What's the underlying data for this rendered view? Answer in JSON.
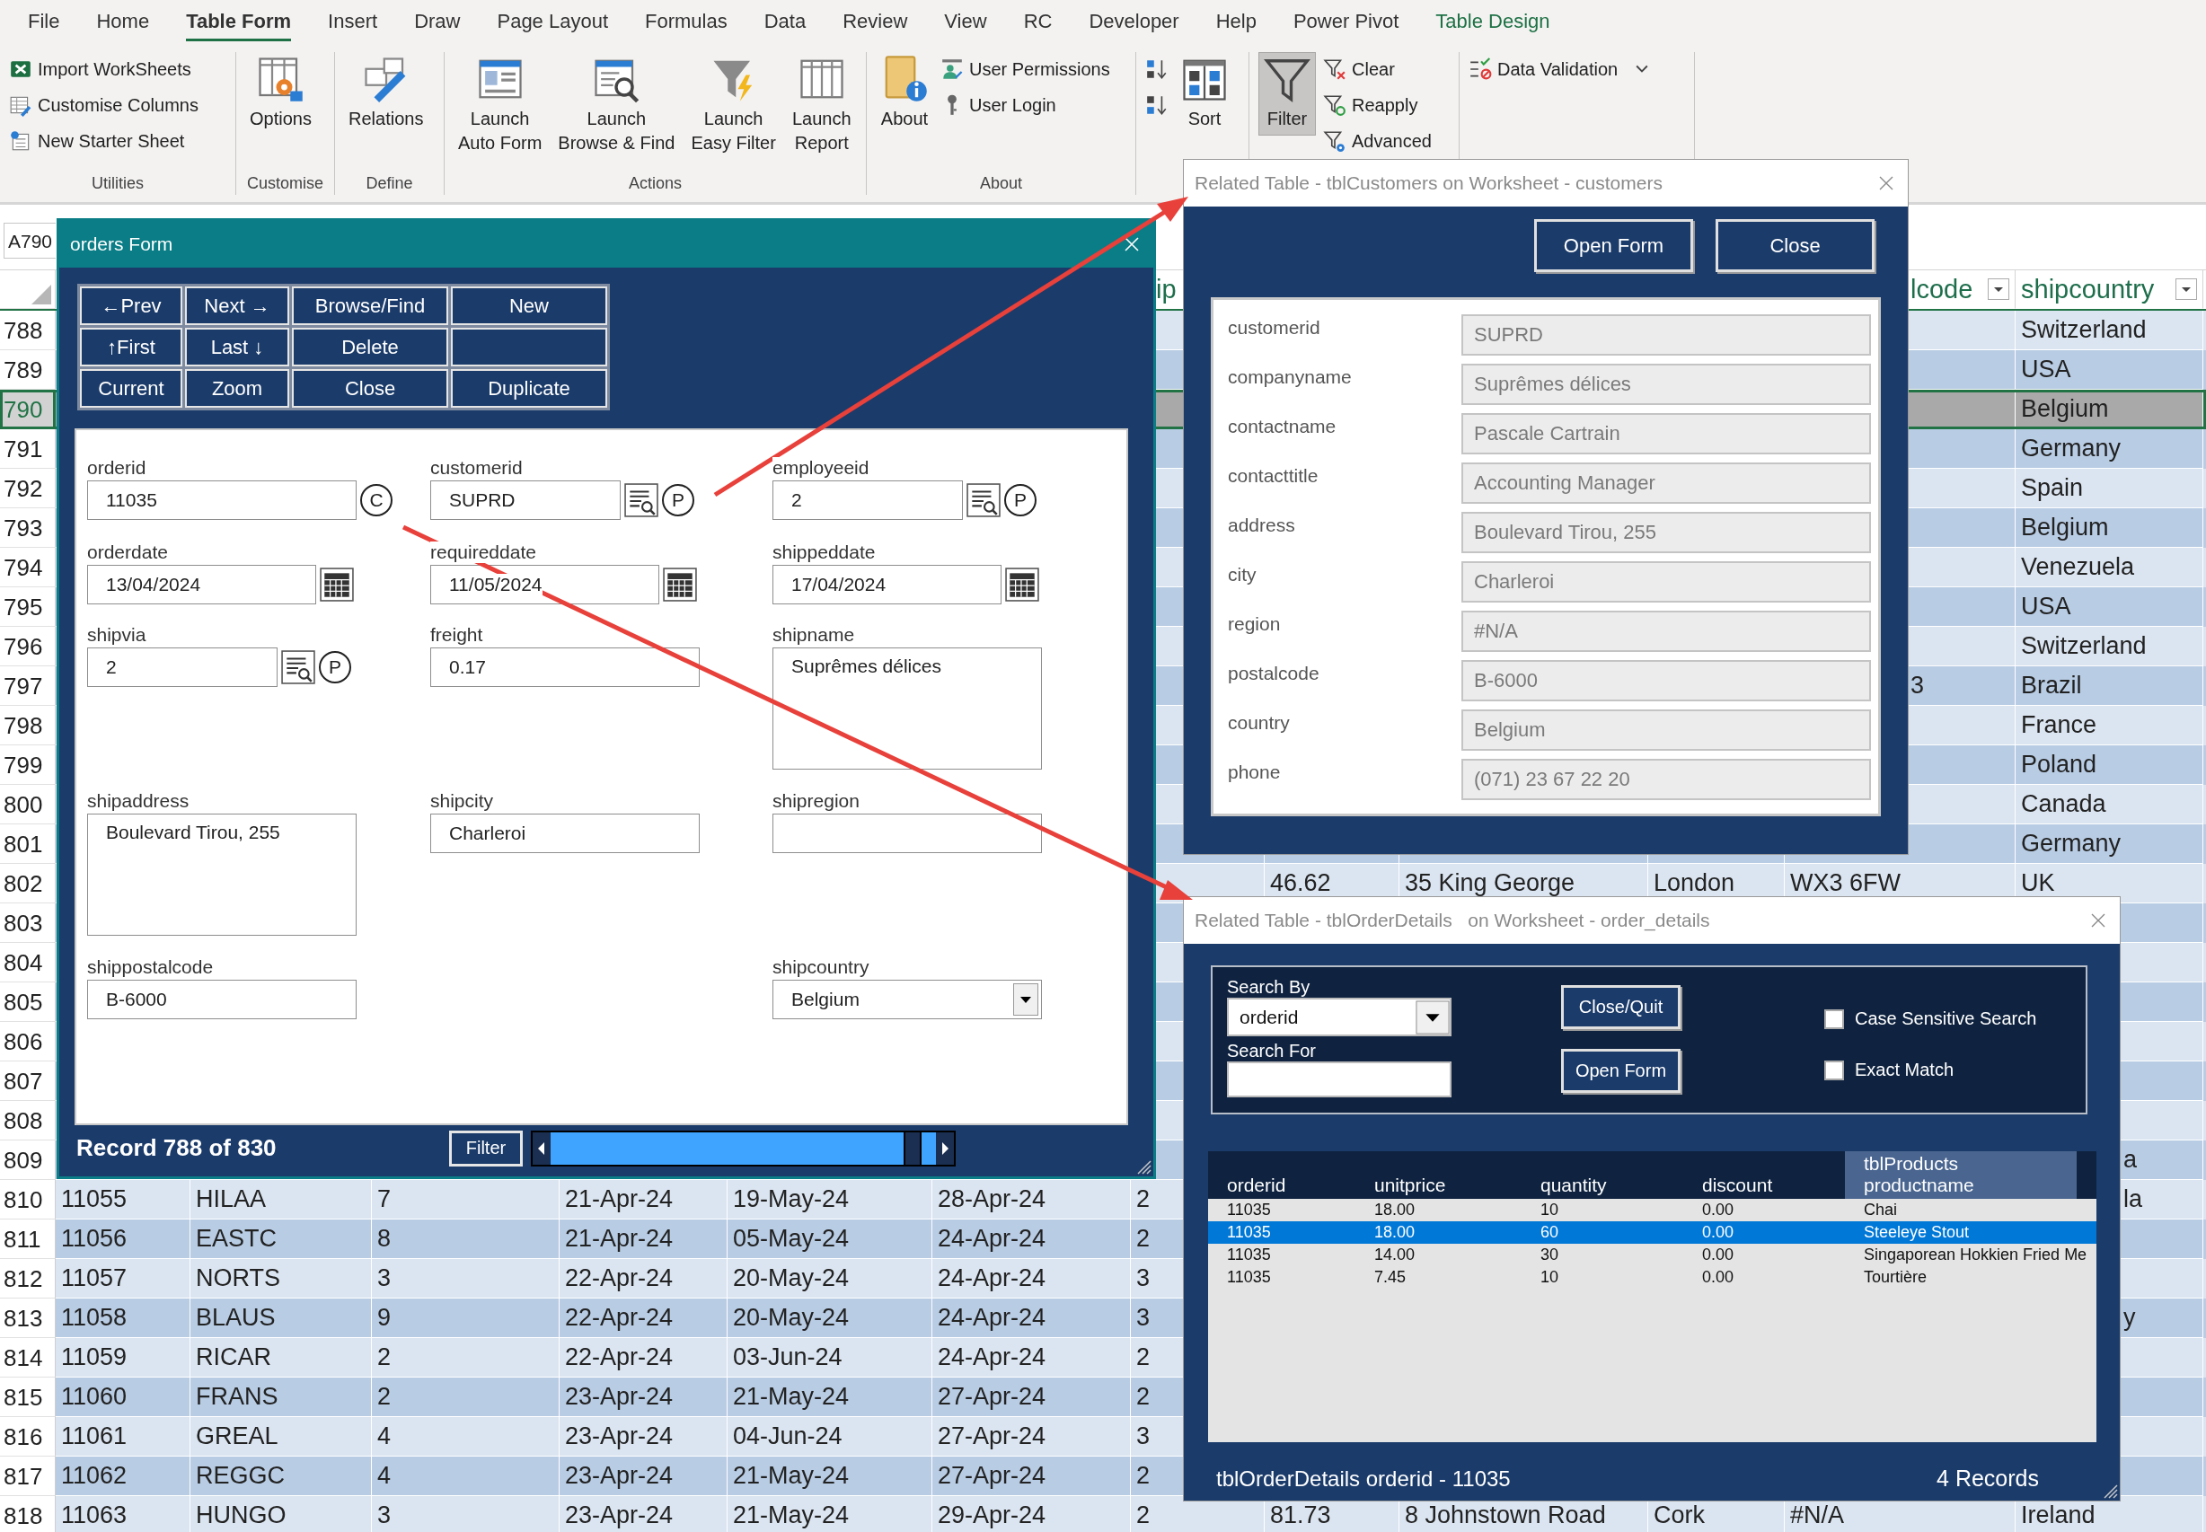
{
  "ribbon": {
    "tabs": [
      {
        "label": "File",
        "selected": false,
        "kind": "tab"
      },
      {
        "label": "Home",
        "selected": false,
        "kind": "tab"
      },
      {
        "label": "Table Form",
        "selected": true,
        "kind": "tab"
      },
      {
        "label": "Insert",
        "selected": false,
        "kind": "tab"
      },
      {
        "label": "Draw",
        "selected": false,
        "kind": "tab"
      },
      {
        "label": "Page Layout",
        "selected": false,
        "kind": "tab"
      },
      {
        "label": "Formulas",
        "selected": false,
        "kind": "tab"
      },
      {
        "label": "Data",
        "selected": false,
        "kind": "tab"
      },
      {
        "label": "Review",
        "selected": false,
        "kind": "tab"
      },
      {
        "label": "View",
        "selected": false,
        "kind": "tab"
      },
      {
        "label": "RC",
        "selected": false,
        "kind": "tab"
      },
      {
        "label": "Developer",
        "selected": false,
        "kind": "tab"
      },
      {
        "label": "Help",
        "selected": false,
        "kind": "tab"
      },
      {
        "label": "Power Pivot",
        "selected": false,
        "kind": "tab"
      },
      {
        "label": "Table Design",
        "selected": false,
        "kind": "contextual"
      }
    ],
    "groups": [
      {
        "label": "Utilities",
        "items": [
          {
            "label": "Import WorkSheets",
            "kind": "small",
            "pressed": false
          },
          {
            "label": "Customise Columns",
            "kind": "small",
            "pressed": false
          },
          {
            "label": "New Starter Sheet",
            "kind": "small",
            "pressed": false
          }
        ]
      },
      {
        "label": "Customise",
        "items": [
          {
            "label": "Options",
            "kind": "large",
            "pressed": false
          }
        ]
      },
      {
        "label": "Define",
        "items": [
          {
            "label": "Relations",
            "kind": "large",
            "pressed": false
          }
        ]
      },
      {
        "label": "Actions",
        "items": [
          {
            "label": "Launch\nAuto Form",
            "kind": "large",
            "pressed": false
          },
          {
            "label": "Launch\nBrowse & Find",
            "kind": "large",
            "pressed": false
          },
          {
            "label": "Launch\nEasy Filter",
            "kind": "large",
            "pressed": false
          },
          {
            "label": "Launch\nReport",
            "kind": "large",
            "pressed": false
          }
        ]
      },
      {
        "label": "About",
        "items": [
          {
            "label": "About",
            "kind": "large",
            "pressed": false
          },
          {
            "label": "User Permissions",
            "kind": "small",
            "pressed": false
          },
          {
            "label": "User Login",
            "kind": "small",
            "pressed": false
          }
        ]
      },
      {
        "items": [
          {
            "kind": "icon",
            "pressed": false
          },
          {
            "kind": "icon",
            "pressed": false
          },
          {
            "label": "Sort",
            "kind": "large",
            "pressed": false
          }
        ]
      },
      {
        "items": [
          {
            "label": "Filter",
            "kind": "large",
            "pressed": true
          },
          {
            "label": "Clear",
            "kind": "small",
            "pressed": false
          },
          {
            "label": "Reapply",
            "kind": "small",
            "pressed": false
          },
          {
            "label": "Advanced",
            "kind": "small",
            "pressed": false
          }
        ]
      },
      {
        "items": [
          {
            "label": "Data Validation",
            "kind": "small_dropdown",
            "pressed": false
          }
        ]
      }
    ]
  },
  "name_box": "A790",
  "sheet": {
    "headers": {
      "column_7": {
        "text": "ip",
        "kind": "fragment"
      },
      "column_11": {
        "text": "lcode",
        "kind": "fragment",
        "filter": true
      },
      "column_12": {
        "text": "shipcountry",
        "filter": true
      }
    },
    "rows": [
      {
        "num": "788",
        "selected": false,
        "cells": {
          "column_12": "Switzerland"
        }
      },
      {
        "num": "789",
        "selected": false,
        "cells": {
          "column_12": "USA"
        }
      },
      {
        "num": "790",
        "selected": true,
        "cells": {
          "column_12": "Belgium"
        }
      },
      {
        "num": "791",
        "selected": false,
        "cells": {
          "column_12": "Germany"
        }
      },
      {
        "num": "792",
        "selected": false,
        "cells": {
          "column_12": "Spain"
        }
      },
      {
        "num": "793",
        "selected": false,
        "cells": {
          "column_12": "Belgium"
        }
      },
      {
        "num": "794",
        "selected": false,
        "cells": {
          "column_12": "Venezuela"
        }
      },
      {
        "num": "795",
        "selected": false,
        "cells": {
          "column_12": "USA"
        }
      },
      {
        "num": "796",
        "selected": false,
        "cells": {
          "column_12": "Switzerland"
        }
      },
      {
        "num": "797",
        "selected": false,
        "cells": {
          "column_11": {
            "text": "3",
            "kind": "fragment"
          },
          "column_12": "Brazil"
        }
      },
      {
        "num": "798",
        "selected": false,
        "cells": {
          "column_12": "France"
        }
      },
      {
        "num": "799",
        "selected": false,
        "cells": {
          "column_12": "Poland"
        }
      },
      {
        "num": "800",
        "selected": false,
        "cells": {
          "column_12": "Canada"
        }
      },
      {
        "num": "801",
        "selected": false,
        "cells": {
          "column_12": "Germany"
        }
      },
      {
        "num": "802",
        "selected": false,
        "cells": {
          "column_8": "46.62",
          "column_9": "35 King George",
          "column_10": "London",
          "column_11": "WX3 6FW",
          "column_12": "UK"
        }
      },
      {
        "num": "803",
        "selected": false
      },
      {
        "num": "804",
        "selected": false
      },
      {
        "num": "805",
        "selected": false
      },
      {
        "num": "806",
        "selected": false
      },
      {
        "num": "807",
        "selected": false
      },
      {
        "num": "808",
        "selected": false
      },
      {
        "num": "809",
        "selected": false,
        "cells": {
          "column_12": {
            "text": "a",
            "kind": "fragment"
          }
        }
      },
      {
        "num": "810",
        "selected": false,
        "cells": {
          "column_1": "11055",
          "column_2": "HILAA",
          "column_3": "7",
          "column_4": "21-Apr-24",
          "column_5": "19-May-24",
          "column_6": "28-Apr-24",
          "column_7": "2",
          "column_12": {
            "text": "la",
            "kind": "fragment"
          }
        }
      },
      {
        "num": "811",
        "selected": false,
        "cells": {
          "column_1": "11056",
          "column_2": "EASTC",
          "column_3": "8",
          "column_4": "21-Apr-24",
          "column_5": "05-May-24",
          "column_6": "24-Apr-24",
          "column_7": "2"
        }
      },
      {
        "num": "812",
        "selected": false,
        "cells": {
          "column_1": "11057",
          "column_2": "NORTS",
          "column_3": "3",
          "column_4": "22-Apr-24",
          "column_5": "20-May-24",
          "column_6": "24-Apr-24",
          "column_7": "3"
        }
      },
      {
        "num": "813",
        "selected": false,
        "cells": {
          "column_1": "11058",
          "column_2": "BLAUS",
          "column_3": "9",
          "column_4": "22-Apr-24",
          "column_5": "20-May-24",
          "column_6": "24-Apr-24",
          "column_7": "3",
          "column_12": {
            "text": "y",
            "kind": "fragment"
          }
        }
      },
      {
        "num": "814",
        "selected": false,
        "cells": {
          "column_1": "11059",
          "column_2": "RICAR",
          "column_3": "2",
          "column_4": "22-Apr-24",
          "column_5": "03-Jun-24",
          "column_6": "24-Apr-24",
          "column_7": "2"
        }
      },
      {
        "num": "815",
        "selected": false,
        "cells": {
          "column_1": "11060",
          "column_2": "FRANS",
          "column_3": "2",
          "column_4": "23-Apr-24",
          "column_5": "21-May-24",
          "column_6": "27-Apr-24",
          "column_7": "2"
        }
      },
      {
        "num": "816",
        "selected": false,
        "cells": {
          "column_1": "11061",
          "column_2": "GREAL",
          "column_3": "4",
          "column_4": "23-Apr-24",
          "column_5": "04-Jun-24",
          "column_6": "27-Apr-24",
          "column_7": "3"
        }
      },
      {
        "num": "817",
        "selected": false,
        "cells": {
          "column_1": "11062",
          "column_2": "REGGC",
          "column_3": "4",
          "column_4": "23-Apr-24",
          "column_5": "21-May-24",
          "column_6": "27-Apr-24",
          "column_7": "2"
        }
      },
      {
        "num": "818",
        "selected": false,
        "cells": {
          "column_1": "11063",
          "column_2": "HUNGO",
          "column_3": "3",
          "column_4": "23-Apr-24",
          "column_5": "21-May-24",
          "column_6": "29-Apr-24",
          "column_7": "2",
          "column_8": "81.73",
          "column_9": "8 Johnstown Road",
          "column_10": "Cork",
          "column_11": "#N/A",
          "column_12": "Ireland"
        }
      }
    ]
  },
  "orders_form": {
    "title": "orders Form",
    "nav_buttons": [
      {
        "label": "←Prev",
        "kind": "button"
      },
      {
        "label": "Next →",
        "kind": "button"
      },
      {
        "label": "Browse/Find",
        "kind": "button"
      },
      {
        "label": "New",
        "kind": "button"
      },
      {
        "label": "↑First",
        "kind": "button"
      },
      {
        "label": "Last ↓",
        "kind": "button"
      },
      {
        "label": "Delete",
        "kind": "button"
      },
      {
        "kind": "empty"
      },
      {
        "label": "Current",
        "kind": "button"
      },
      {
        "label": "Zoom",
        "kind": "button"
      },
      {
        "label": "Close",
        "kind": "button"
      },
      {
        "label": "Duplicate",
        "kind": "button"
      }
    ],
    "fields": [
      [
        {
          "label": "orderid",
          "value": "11035",
          "kind": "badge",
          "badge": "C"
        },
        {
          "label": "orderdate",
          "value": "13/04/2024",
          "kind": "date"
        },
        {
          "label": "shipvia",
          "value": "2",
          "kind": "lookup",
          "badge": "P"
        },
        {
          "label": "shipaddress",
          "value": "Boulevard Tirou, 255",
          "kind": "memo"
        },
        {
          "label": "shippostalcode",
          "value": "B-6000",
          "kind": "text"
        }
      ],
      [
        {
          "label": "customerid",
          "value": "SUPRD",
          "kind": "lookup",
          "badge": "P"
        },
        {
          "label": "requireddate",
          "value": "11/05/2024",
          "kind": "date"
        },
        {
          "label": "freight",
          "value": "0.17",
          "kind": "text"
        },
        {
          "label": "shipcity",
          "value": "Charleroi",
          "kind": "text"
        }
      ],
      [
        {
          "label": "employeeid",
          "value": "2",
          "kind": "lookup",
          "badge": "P"
        },
        {
          "label": "shippeddate",
          "value": "17/04/2024",
          "kind": "date"
        },
        {
          "label": "shipname",
          "value": "Suprêmes délices",
          "kind": "memo"
        },
        {
          "label": "shipregion",
          "kind": "text"
        },
        {
          "label": "shipcountry",
          "value": "Belgium",
          "kind": "dropdown"
        }
      ]
    ],
    "record_label": "Record 788 of 830",
    "filter_button": "Filter"
  },
  "customers_dialog": {
    "title": "Related Table - tblCustomers on Worksheet - customers",
    "buttons": [
      "Open Form",
      "Close"
    ],
    "fields": [
      {
        "label": "customerid",
        "value": "SUPRD"
      },
      {
        "label": "companyname",
        "value": "Suprêmes délices"
      },
      {
        "label": "contactname",
        "value": "Pascale Cartrain"
      },
      {
        "label": "contacttitle",
        "value": "Accounting Manager"
      },
      {
        "label": "address",
        "value": "Boulevard Tirou, 255"
      },
      {
        "label": "city",
        "value": "Charleroi"
      },
      {
        "label": "region",
        "value": "#N/A"
      },
      {
        "label": "postalcode",
        "value": "B-6000"
      },
      {
        "label": "country",
        "value": "Belgium"
      },
      {
        "label": "phone",
        "value": "(071) 23 67 22 20"
      }
    ]
  },
  "details_dialog": {
    "title": "Related Table - tblOrderDetails   on Worksheet - order_details",
    "search_by_label": "Search By",
    "search_by": "orderid",
    "search_for_label": "Search For",
    "buttons": [
      "Close/Quit",
      "Open Form"
    ],
    "options": [
      {
        "label": "Case Sensitive Search",
        "checked": false
      },
      {
        "label": "Exact Match",
        "checked": false
      }
    ],
    "columns": [
      {
        "label": "orderid",
        "selected": false
      },
      {
        "label": "unitprice",
        "selected": false
      },
      {
        "label": "quantity",
        "selected": false
      },
      {
        "label": "discount",
        "selected": false
      },
      {
        "label": "tblProducts\nproductname",
        "selected": true
      }
    ],
    "rows": [
      {
        "cells": [
          "11035",
          "18.00",
          "10",
          "0.00",
          "Chai"
        ],
        "selected": false
      },
      {
        "cells": [
          "11035",
          "18.00",
          "60",
          "0.00",
          "Steeleye Stout"
        ],
        "selected": true
      },
      {
        "cells": [
          "11035",
          "14.00",
          "30",
          "0.00",
          "Singaporean Hokkien Fried Me"
        ],
        "selected": false
      },
      {
        "cells": [
          "11035",
          "7.45",
          "10",
          "0.00",
          "Tourtière"
        ],
        "selected": false
      }
    ],
    "status": "tblOrderDetails orderid - 11035",
    "count": "4 Records"
  }
}
